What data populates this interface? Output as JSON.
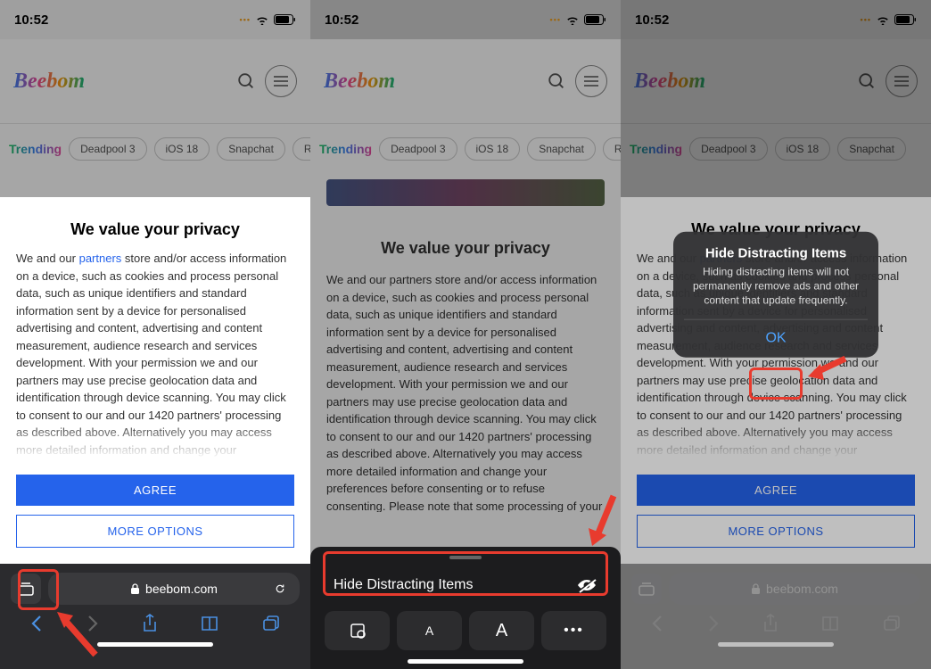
{
  "status": {
    "time": "10:52"
  },
  "header": {
    "logo": "Beebom"
  },
  "trending": {
    "label": "Trending",
    "items": [
      "Deadpool 3",
      "iOS 18",
      "Snapchat",
      "R"
    ]
  },
  "privacy": {
    "title": "We value your privacy",
    "body_pre": "We and our ",
    "partners": "partners",
    "body_mid": " store and/or access information on a device, such as cookies and process personal data, such as unique identifiers and standard information sent by a device for personalised advertising and content, advertising and content measurement, audience research and services development. With your permission we and our partners may use precise geolocation data and identification through device scanning. You may click to consent to our and our 1420 partners' processing as described above. Alternatively you may access more detailed information and change your",
    "body_full": " store and/or access information on a device, such as cookies and process personal data, such as unique identifiers and standard information sent by a device for personalised advertising and content, advertising and content measurement, audience research and services development. With your permission we and our partners may use precise geolocation data and identification through device scanning. You may click to consent to our and our 1420 partners' processing as described above. Alternatively you may access more detailed information and change your preferences before consenting or to refuse consenting. Please note that some processing of your personal data may not require your consent, but you",
    "agree": "AGREE",
    "more": "MORE OPTIONS"
  },
  "safari": {
    "url": "beebom.com"
  },
  "reader": {
    "hide_label": "Hide Distracting Items"
  },
  "alert": {
    "title": "Hide Distracting Items",
    "body": "Hiding distracting items will not permanently remove ads and other content that update frequently.",
    "ok": "OK"
  }
}
